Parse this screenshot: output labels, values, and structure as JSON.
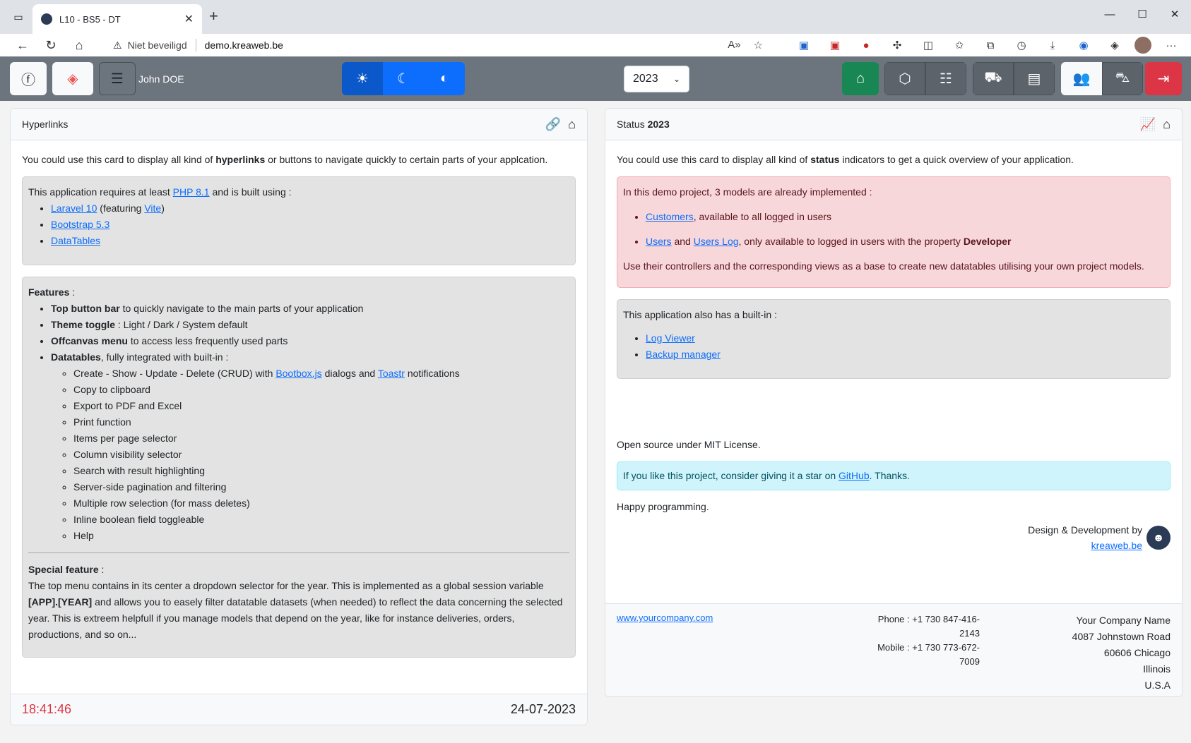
{
  "browser": {
    "tab_title": "L10 - BS5 - DT",
    "security_label": "Niet beveiligd",
    "url": "demo.kreaweb.be"
  },
  "topbar": {
    "username": "John DOE",
    "year": "2023"
  },
  "left_card": {
    "title": "Hyperlinks",
    "intro_pre": "You could use this card to display all kind of ",
    "intro_bold": "hyperlinks",
    "intro_post": " or buttons to navigate quickly to certain parts of your applcation.",
    "req_pre": "This application requires at least ",
    "req_link": "PHP 8.1",
    "req_post": " and is built using :",
    "built": {
      "laravel": "Laravel 10",
      "featuring_pre": " (featuring ",
      "vite": "Vite",
      "featuring_post": ")",
      "bootstrap": "Bootstrap 5.3",
      "datatables": "DataTables"
    },
    "features_title": "Features",
    "features_colon": " :",
    "features": [
      {
        "bold": "Top button bar",
        "text": " to quickly navigate to the main parts of your application"
      },
      {
        "bold": "Theme toggle",
        "text": " : Light / Dark / System default"
      },
      {
        "bold": "Offcanvas menu",
        "text": " to access less frequently used parts"
      },
      {
        "bold": "Datatables",
        "text": ", fully integrated with built-in :"
      }
    ],
    "crud": {
      "pre": "Create - Show - Update - Delete (CRUD) with ",
      "bootbox": "Bootbox.js",
      "mid": " dialogs and ",
      "toastr": "Toastr",
      "post": " notifications"
    },
    "sub_features": [
      "Copy to clipboard",
      "Export to PDF and Excel",
      "Print function",
      "Items per page selector",
      "Column visibility selector",
      "Search with result highlighting",
      "Server-side pagination and filtering",
      "Multiple row selection (for mass deletes)",
      "Inline boolean field toggleable",
      "Help"
    ],
    "special_title": "Special feature",
    "special_colon": " :",
    "special_pre": "The top menu contains in its center a dropdown selector for the year. This is implemented as a global session variable ",
    "special_bold": "[APP].[YEAR]",
    "special_post": " and allows you to easely filter datatable datasets (when needed) to reflect the data concerning the selected year. This is extreem helpfull if you manage models that depend on the year, like for instance deliveries, orders, productions, and so on...",
    "clock": "18:41:46",
    "date": "24-07-2023"
  },
  "right_card": {
    "title_pre": "Status ",
    "title_year": "2023",
    "intro_pre": "You could use this card to display all kind of ",
    "intro_bold": "status",
    "intro_post": " indicators to get a quick overview of your application.",
    "demo_text": "In this demo project, 3 models are already implemented :",
    "customers": "Customers",
    "customers_post": ", available to all logged in users",
    "users": "Users",
    "and": " and ",
    "users_log": "Users Log",
    "users_post": ", only available to logged in users with the property ",
    "developer": "Developer",
    "controllers_text": "Use their controllers and the corresponding views as a base to create new datatables utilising your own project models.",
    "builtin_text": "This application also has a built-in :",
    "log_viewer": "Log Viewer",
    "backup_manager": "Backup manager",
    "license": "Open source under MIT License.",
    "star_pre": "If you like this project, consider giving it a star on ",
    "github": "GitHub",
    "star_post": ". Thanks.",
    "happy": "Happy programming.",
    "design_by": "Design & Development by",
    "kreaweb": "kreaweb.be",
    "company_url": "www.yourcompany.com",
    "phone": "Phone : +1 730 847-416-2143",
    "mobile": "Mobile : +1 730 773-672-7009",
    "address": [
      "Your Company Name",
      "4087 Johnstown Road",
      "60606 Chicago",
      "Illinois",
      "U.S.A"
    ]
  },
  "colors": {
    "primary": "#0d6efd",
    "success": "#198754",
    "danger": "#dc3545",
    "bar": "#6c757d"
  }
}
